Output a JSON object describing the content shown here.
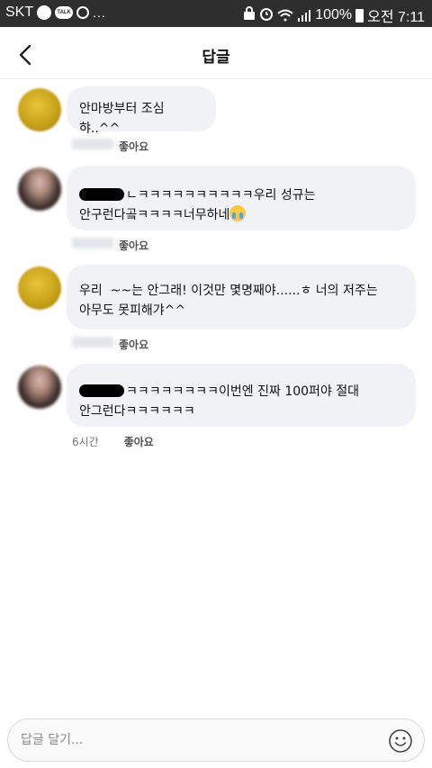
{
  "status_bar": {
    "carrier": "SKT",
    "talk_badge": "TALK",
    "dots": "...",
    "battery": "100%",
    "time": "오전 7:11"
  },
  "header": {
    "title": "답글",
    "back_icon": "chevron-left-icon"
  },
  "comments": [
    {
      "text": "안마방부터 조심햐..^^",
      "time": "",
      "like": "좋아요"
    },
    {
      "text_line1": "ㄴㅋㅋㅋㅋㅋㅋㅋㅋㅋㅋ우리 성규는",
      "text_line2": "안구런다곸ㅋㅋㅋㅋ너무하네",
      "emoji": "crying-face-emoji",
      "time": "",
      "like": "좋아요"
    },
    {
      "text_line1": "우리  ~~는 안그래! 이것만 몇명째야......ㅎ 너의 저주는",
      "text_line2": "아무도 못피해갸^^",
      "time": "",
      "like": "좋아요"
    },
    {
      "text_line1": "ㅋㅋㅋㅋㅋㅋㅋㅋ이번엔 진짜 100퍼야 절대",
      "text_line2": "안그런다ㅋㅋㅋㅋㅋㅋ",
      "time": "6시간",
      "like": "좋아요"
    }
  ],
  "input": {
    "placeholder": "답글 달기...",
    "emoji_icon": "smiley-icon"
  },
  "colors": {
    "status_bar_bg": "#2e2e2e",
    "bubble_bg": "#f1f2f6"
  }
}
